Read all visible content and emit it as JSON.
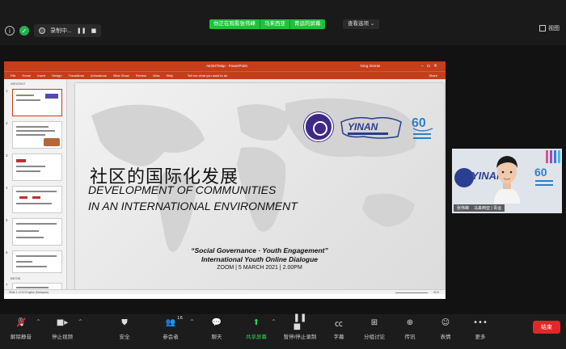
{
  "meeting": {
    "recording_label": "录制中...",
    "share_banner": [
      "你正在观看张伟峰",
      "马来西亚",
      "青运的屏幕"
    ],
    "view_options": "查看选项 ⌄",
    "view_button": "视图"
  },
  "ppt": {
    "doc_title": "AKSHTMap · PowerPoint",
    "user": "Yong Xinmei",
    "menu": [
      "File",
      "Home",
      "Insert",
      "Design",
      "Transitions",
      "Animations",
      "Slide Show",
      "Review",
      "View",
      "Help"
    ],
    "tell_me": "Tell me what you want to do",
    "share_label": "Share",
    "sections": [
      "WEICENT",
      "BEGIN"
    ],
    "slide_numbers": [
      "1",
      "2",
      "3",
      "4",
      "5",
      "6",
      "7"
    ],
    "status_left": "Slide 1 of 10  English (Malaysia)",
    "status_zoom": "91%"
  },
  "slide": {
    "title_cn": "社区的国际化发展",
    "title_en_line1": "DEVELOPMENT OF COMMUNITIES",
    "title_en_line2": "IN AN INTERNATIONAL ENVIRONMENT",
    "subtitle1": "“Social Governance · Youth Engagement”",
    "subtitle2": "International Youth Online Dialogue",
    "subtitle3": "ZOOM  |  5 MARCH 2021  |  2.00PM",
    "logo_text": "YINAN",
    "logo_60": "60"
  },
  "video": {
    "participant_name": "张伟峰",
    "participant_org": "马来西亚 | 青运",
    "bg_text": "YINAN"
  },
  "toolbar": {
    "unmute": "解除静音",
    "stop_video": "停止视频",
    "security": "安全",
    "participants": "参会者",
    "participant_count": "16",
    "chat": "聊天",
    "share_screen": "共享屏幕",
    "pause_record": "暂停/停止录制",
    "captions": "字幕",
    "breakout": "分组讨论",
    "reactions": "传讯",
    "emoji": "表情",
    "more": "更多",
    "end": "结束"
  }
}
